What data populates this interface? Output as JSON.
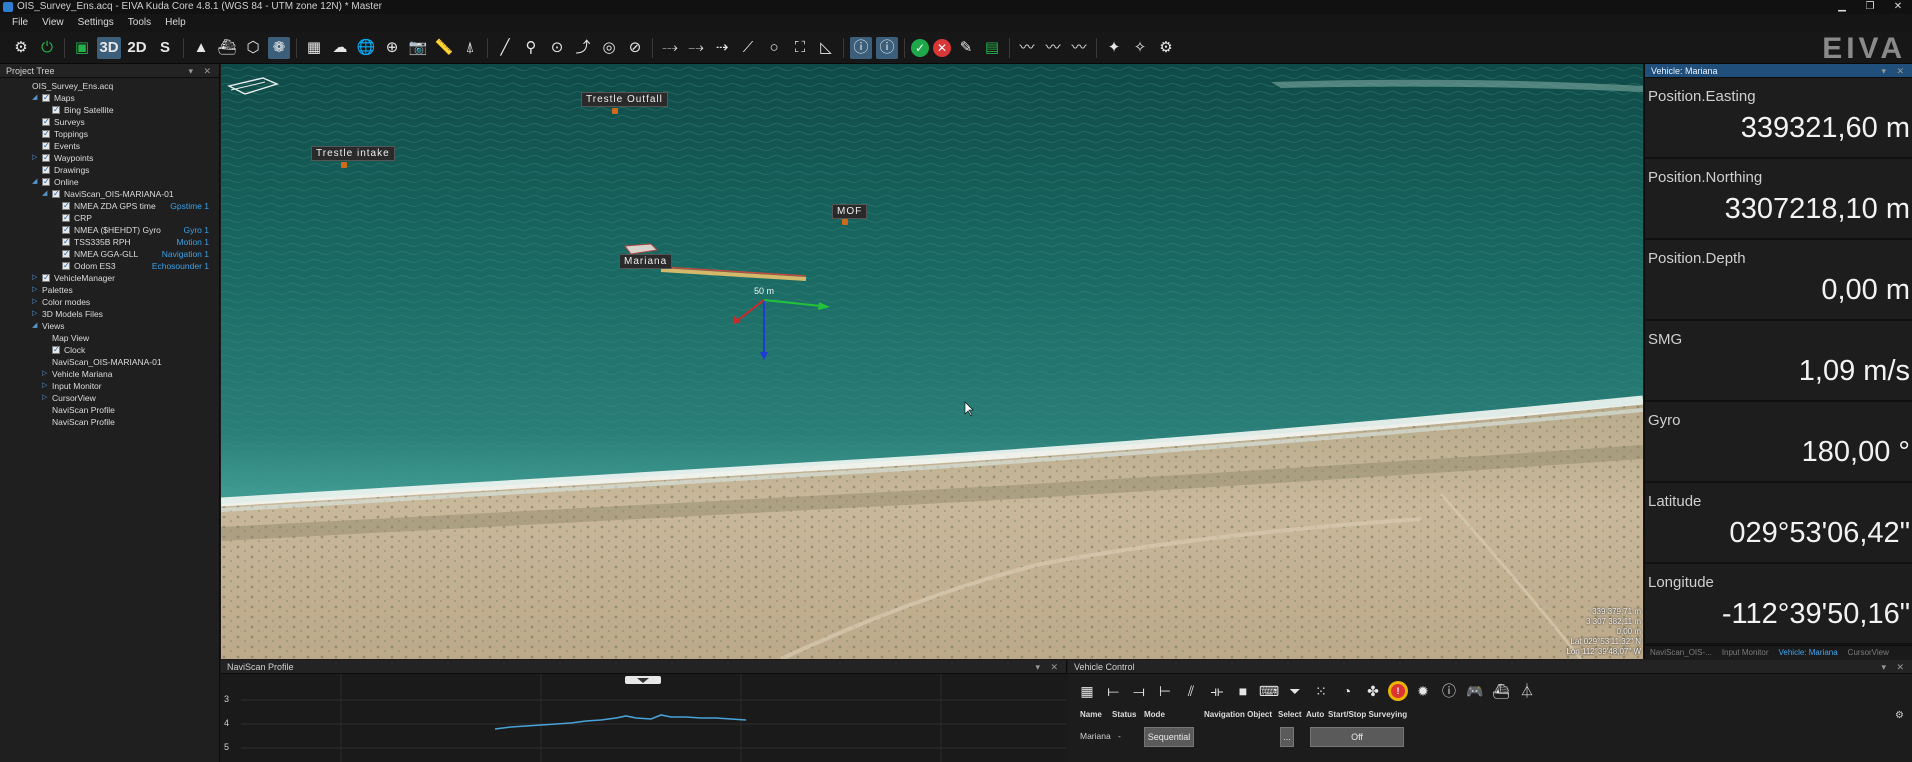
{
  "window": {
    "title": "OIS_Survey_Ens.acq - EIVA Kuda Core 4.8.1 (WGS 84 - UTM zone 12N) * Master",
    "controls": [
      "▁",
      "❐",
      "✕"
    ]
  },
  "menu": [
    "File",
    "View",
    "Settings",
    "Tools",
    "Help"
  ],
  "toolbar": {
    "view_3d": "3D",
    "view_2d": "2D",
    "view_s": "S",
    "brand": "EIVA"
  },
  "project_tree": {
    "title": "Project Tree",
    "controls": "▾ ✕",
    "items": [
      {
        "label": "OIS_Survey_Ens.acq",
        "indent": 0,
        "arrow": "",
        "checkbox": "none",
        "tag": ""
      },
      {
        "label": "Maps",
        "indent": 1,
        "arrow": "◢",
        "checkbox": "on",
        "tag": ""
      },
      {
        "label": "Bing Satellite",
        "indent": 2,
        "arrow": "",
        "checkbox": "on",
        "tag": ""
      },
      {
        "label": "Surveys",
        "indent": 1,
        "arrow": "",
        "checkbox": "on",
        "tag": ""
      },
      {
        "label": "Toppings",
        "indent": 1,
        "arrow": "",
        "checkbox": "on",
        "tag": ""
      },
      {
        "label": "Events",
        "indent": 1,
        "arrow": "",
        "checkbox": "on",
        "tag": ""
      },
      {
        "label": "Waypoints",
        "indent": 1,
        "arrow": "▷",
        "checkbox": "on",
        "tag": ""
      },
      {
        "label": "Drawings",
        "indent": 1,
        "arrow": "",
        "checkbox": "on",
        "tag": ""
      },
      {
        "label": "Online",
        "indent": 1,
        "arrow": "◢",
        "checkbox": "on",
        "tag": ""
      },
      {
        "label": "NaviScan_OIS-MARIANA-01",
        "indent": 2,
        "arrow": "◢",
        "checkbox": "on",
        "tag": ""
      },
      {
        "label": "NMEA ZDA GPS time",
        "indent": 3,
        "arrow": "",
        "checkbox": "on",
        "tag": "Gpstime 1"
      },
      {
        "label": "CRP",
        "indent": 3,
        "arrow": "",
        "checkbox": "on",
        "tag": ""
      },
      {
        "label": "NMEA ($HEHDT) Gyro",
        "indent": 3,
        "arrow": "",
        "checkbox": "on",
        "tag": "Gyro 1"
      },
      {
        "label": "TSS335B RPH",
        "indent": 3,
        "arrow": "",
        "checkbox": "on",
        "tag": "Motion 1"
      },
      {
        "label": "NMEA GGA-GLL",
        "indent": 3,
        "arrow": "",
        "checkbox": "on",
        "tag": "Navigation 1"
      },
      {
        "label": "Odom ES3",
        "indent": 3,
        "arrow": "",
        "checkbox": "on",
        "tag": "Echosounder 1"
      },
      {
        "label": "VehicleManager",
        "indent": 1,
        "arrow": "▷",
        "checkbox": "on",
        "tag": ""
      },
      {
        "label": "Palettes",
        "indent": 1,
        "arrow": "▷",
        "checkbox": "none",
        "tag": ""
      },
      {
        "label": "Color modes",
        "indent": 1,
        "arrow": "▷",
        "checkbox": "none",
        "tag": ""
      },
      {
        "label": "3D Models Files",
        "indent": 1,
        "arrow": "▷",
        "checkbox": "none",
        "tag": ""
      },
      {
        "label": "Views",
        "indent": 1,
        "arrow": "◢",
        "checkbox": "none",
        "tag": ""
      },
      {
        "label": "Map View",
        "indent": 2,
        "arrow": "",
        "checkbox": "none",
        "tag": ""
      },
      {
        "label": "Clock",
        "indent": 2,
        "arrow": "",
        "checkbox": "on",
        "tag": ""
      },
      {
        "label": "NaviScan_OIS-MARIANA-01",
        "indent": 2,
        "arrow": "",
        "checkbox": "none",
        "tag": ""
      },
      {
        "label": "Vehicle   Mariana",
        "indent": 2,
        "arrow": "▷",
        "checkbox": "none",
        "tag": ""
      },
      {
        "label": "Input Monitor",
        "indent": 2,
        "arrow": "▷",
        "checkbox": "none",
        "tag": ""
      },
      {
        "label": "CursorView",
        "indent": 2,
        "arrow": "▷",
        "checkbox": "none",
        "tag": ""
      },
      {
        "label": "NaviScan Profile",
        "indent": 2,
        "arrow": "",
        "checkbox": "none",
        "tag": ""
      },
      {
        "label": "NaviScan Profile",
        "indent": 2,
        "arrow": "",
        "checkbox": "none",
        "tag": ""
      }
    ]
  },
  "map": {
    "labels": {
      "trestle_outfall": "Trestle Outfall",
      "trestle_intake": "Trestle intake",
      "mof": "MOF",
      "vessel": "Mariana",
      "scale": "50 m"
    },
    "coordinates": [
      "339 379,71 m",
      "3 307 382,11 m",
      "0,00 m",
      "Lat 029°53'11,32\" N",
      "Lon 112°39'48,07\" W"
    ]
  },
  "vehicle_panel": {
    "title": "Vehicle: Mariana",
    "controls": "▾ ✕",
    "readouts": [
      {
        "label": "Position.Easting",
        "value": "339321,60 m"
      },
      {
        "label": "Position.Northing",
        "value": "3307218,10 m"
      },
      {
        "label": "Position.Depth",
        "value": "0,00 m"
      },
      {
        "label": "SMG",
        "value": "1,09 m/s"
      },
      {
        "label": "Gyro",
        "value": "180,00 °"
      },
      {
        "label": "Latitude",
        "value": "029°53'06,42\""
      },
      {
        "label": "Longitude",
        "value": "-112°39'50,16\""
      }
    ],
    "tabs": [
      "NaviScan_OIS-...",
      "Input Monitor",
      "Vehicle: Mariana",
      "CursorView"
    ],
    "active_tab": 2
  },
  "naviscan_profile": {
    "title": "NaviScan Profile",
    "controls": "▾ ✕",
    "y_ticks": [
      "3",
      "4",
      "5"
    ]
  },
  "vehicle_control": {
    "title": "Vehicle Control",
    "controls": "▾ ✕",
    "columns": [
      "Name",
      "Status",
      "Mode",
      "Navigation Object",
      "Select",
      "Auto",
      "Start/Stop Surveying"
    ],
    "row": {
      "name": "Mariana",
      "status": "-",
      "mode": "Sequential",
      "select": "...",
      "surveying": "Off"
    }
  }
}
